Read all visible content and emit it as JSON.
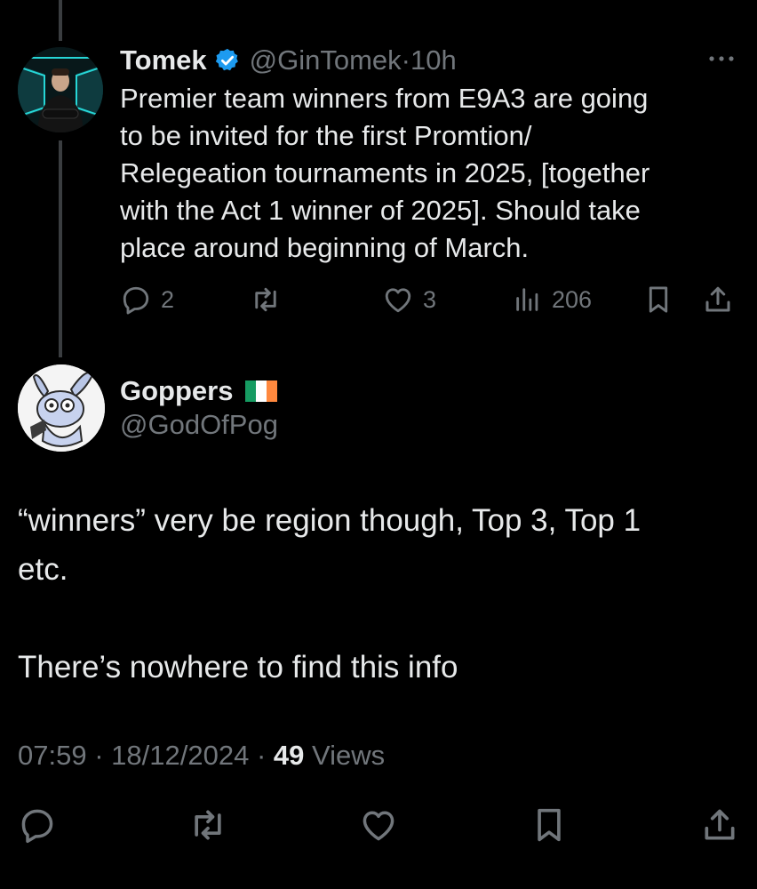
{
  "colors": {
    "background": "#000000",
    "text_primary": "#e7e9ea",
    "text_secondary": "#71767b",
    "verified_badge": "#1d9bf0",
    "thread_line": "#3a3d40"
  },
  "parent_tweet": {
    "display_name": "Tomek",
    "verified": true,
    "handle": "@GinTomek",
    "separator": "·",
    "time": "10h",
    "text": "Premier team winners from E9A3 are going\nto be invited for the first Promtion/\nRelegeation tournaments in 2025, [together\nwith the Act 1 winner of 2025]. Should take\nplace around beginning of March.",
    "actions": {
      "replies": "2",
      "retweets": "",
      "likes": "3",
      "views": "206"
    },
    "icons": [
      "reply-icon",
      "retweet-icon",
      "like-icon",
      "views-icon",
      "bookmark-icon",
      "share-icon",
      "more-icon",
      "verified-icon"
    ]
  },
  "reply_tweet": {
    "display_name": "Goppers",
    "flag": "Ireland",
    "handle": "@GodOfPog",
    "text": "“winners” very be region though, Top 3, Top 1\netc.\n\nThere’s nowhere to find this info",
    "time": "07:59",
    "date": "18/12/2024",
    "separator": "·",
    "views_count": "49",
    "views_label": "Views",
    "icons": [
      "reply-icon",
      "retweet-icon",
      "like-icon",
      "bookmark-icon",
      "share-icon"
    ]
  }
}
